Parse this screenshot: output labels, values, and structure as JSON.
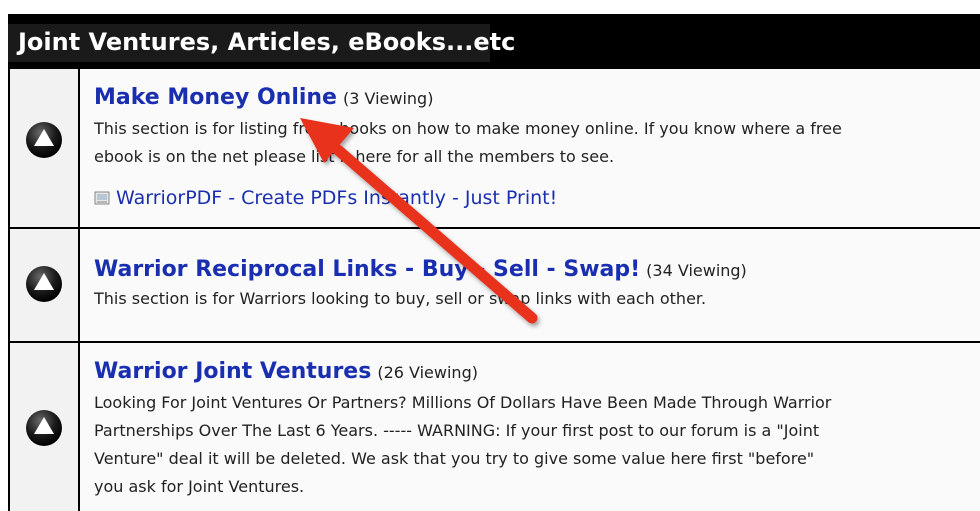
{
  "category": {
    "title": "Joint Ventures, Articles, eBooks...etc"
  },
  "forums": [
    {
      "title": "Make Money Online",
      "viewing": "(3 Viewing)",
      "description_lines": [
        "This section is for listing free ebooks on how to make money online. If you know where a free",
        "ebook is on the net please list it here for all the members to see."
      ],
      "sublink": "WarriorPDF - Create PDFs Instantly - Just Print!"
    },
    {
      "title": "Warrior Reciprocal Links - Buy - Sell - Swap!",
      "viewing": "(34 Viewing)",
      "description_lines": [
        "This section is for Warriors looking to buy, sell or swap links with each other."
      ]
    },
    {
      "title": "Warrior Joint Ventures",
      "viewing": "(26 Viewing)",
      "description_lines": [
        "Looking For Joint Ventures Or Partners? Millions Of Dollars Have Been Made Through Warrior",
        "Partnerships Over The Last 6 Years. ----- WARNING: If your first post to our forum is a \"Joint",
        "Venture\" deal it will be deleted. We ask that you try to give some value here first \"before\"",
        "you ask for Joint Ventures."
      ]
    }
  ],
  "icons": {
    "forum_status": "forum-read-icon",
    "sublink": "document-icon"
  },
  "colors": {
    "link": "#1a2fb0",
    "header_bg": "#000000",
    "arrow": "#e8301f"
  }
}
